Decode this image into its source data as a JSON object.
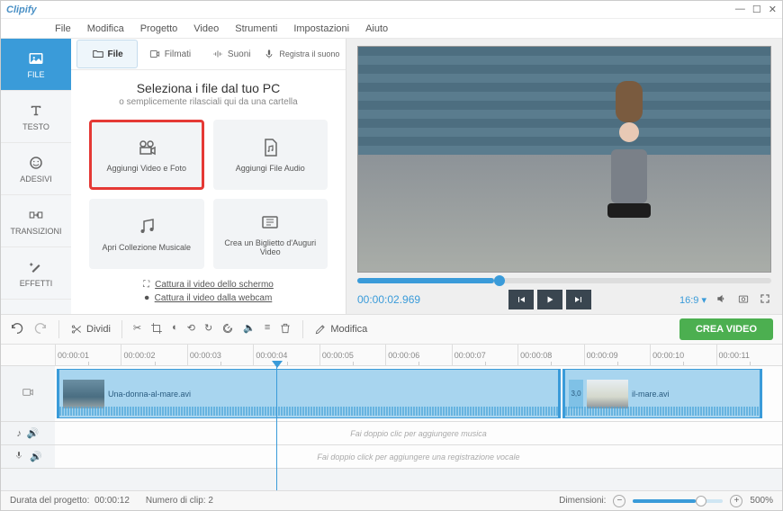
{
  "app_name": "Clipify",
  "menu": [
    "File",
    "Modifica",
    "Progetto",
    "Video",
    "Strumenti",
    "Impostazioni",
    "Aiuto"
  ],
  "sidebar": [
    {
      "label": "FILE",
      "icon": "image-icon"
    },
    {
      "label": "TESTO",
      "icon": "text-icon"
    },
    {
      "label": "ADESIVI",
      "icon": "sticker-icon"
    },
    {
      "label": "TRANSIZIONI",
      "icon": "transitions-icon"
    },
    {
      "label": "EFFETTI",
      "icon": "effects-icon"
    }
  ],
  "file_tabs": [
    {
      "label": "File"
    },
    {
      "label": "Filmati"
    },
    {
      "label": "Suoni"
    },
    {
      "label": "Registra il suono"
    }
  ],
  "file_panel": {
    "heading": "Seleziona i file dal tuo PC",
    "subheading": "o semplicemente rilasciali qui da una cartella",
    "tiles": [
      {
        "label": "Aggiungi Video e Foto"
      },
      {
        "label": "Aggiungi File Audio"
      },
      {
        "label": "Apri Collezione Musicale"
      },
      {
        "label": "Crea un Biglietto d'Auguri Video"
      }
    ],
    "capture_screen": "Cattura il video dello schermo",
    "capture_webcam": "Cattura il video dalla webcam"
  },
  "preview": {
    "time": "00:00:02.969",
    "aspect": "16:9",
    "aspect_dropdown": "▾"
  },
  "toolbar": {
    "split": "Dividi",
    "modify": "Modifica",
    "create": "CREA VIDEO"
  },
  "ruler": [
    "00:00:01",
    "00:00:02",
    "00:00:03",
    "00:00:04",
    "00:00:05",
    "00:00:06",
    "00:00:07",
    "00:00:08",
    "00:00:09",
    "00:00:10",
    "00:00:11"
  ],
  "clips": [
    {
      "name": "Una-donna-al-mare.avi"
    },
    {
      "name": "il-mare.avi",
      "badge": "3,0"
    }
  ],
  "empty_music": "Fai doppio clic per aggiungere musica",
  "empty_voice": "Fai doppio click per aggiungere una registrazione vocale",
  "status": {
    "duration_label": "Durata del progetto:",
    "duration_value": "00:00:12",
    "clips_label": "Numero di clip:",
    "clips_value": "2",
    "zoom_label": "Dimensioni:",
    "zoom_value": "500%"
  }
}
